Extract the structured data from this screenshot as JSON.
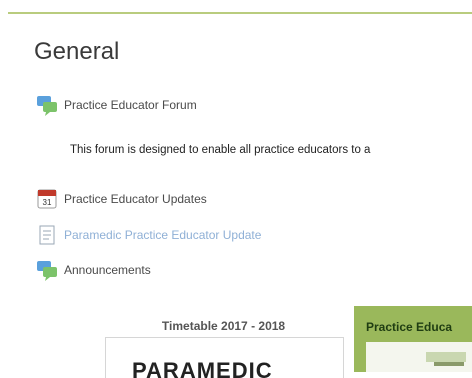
{
  "section": {
    "title": "General"
  },
  "activities": [
    {
      "label": "Practice Educator Forum",
      "icon": "forum-icon"
    },
    {
      "label": "Practice Educator Updates",
      "icon": "calendar-icon"
    },
    {
      "label": "Paramedic Practice Educator Update",
      "icon": "page-icon"
    },
    {
      "label": "Announcements",
      "icon": "forum-icon"
    }
  ],
  "forum_description": "This forum is designed to enable all practice educators to a",
  "tiles": [
    {
      "caption": "Timetable 2017 - 2018",
      "poster_text": "PARAMEDIC"
    },
    {
      "caption": "Practice Educa"
    }
  ],
  "colors": {
    "accent_line": "#b9cc7e",
    "tile_green": "#9ab85b",
    "muted_link": "#8fb0d6"
  }
}
